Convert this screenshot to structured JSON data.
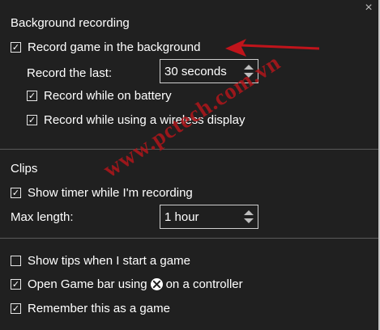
{
  "window": {
    "close_glyph": "×"
  },
  "background_recording": {
    "heading": "Background recording",
    "record_game_in_background": {
      "label": "Record game in the background",
      "checked": true
    },
    "record_the_last": {
      "label": "Record the last:",
      "value": "30 seconds"
    },
    "record_on_battery": {
      "label": "Record while on battery",
      "checked": true
    },
    "record_wireless_display": {
      "label": "Record while using a wireless display",
      "checked": true
    }
  },
  "clips": {
    "heading": "Clips",
    "show_timer": {
      "label": "Show timer while I'm recording",
      "checked": true
    },
    "max_length": {
      "label": "Max length:",
      "value": "1 hour"
    }
  },
  "general": {
    "show_tips": {
      "label": "Show tips when I start a game",
      "checked": false
    },
    "open_game_bar": {
      "label_before": "Open Game bar using",
      "label_after": "on a controller",
      "checked": true,
      "icon": "xbox-logo-icon"
    },
    "remember_game": {
      "label": "Remember this as a game",
      "checked": true
    }
  },
  "annotation": {
    "arrow_color": "#c0141b"
  },
  "watermark": {
    "text": "www.pctech.com.vn",
    "color": "#b1161b"
  },
  "colors": {
    "background": "#202020",
    "text": "#ffffff",
    "divider": "#5a5a5a"
  }
}
